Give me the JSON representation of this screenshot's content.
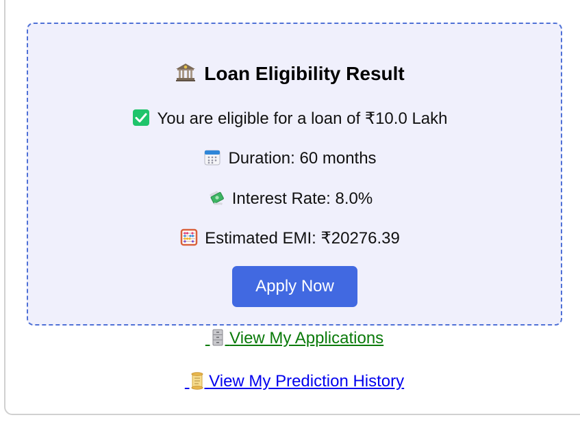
{
  "result": {
    "title": "Loan Eligibility Result",
    "eligible_text": "You are eligible for a loan of ₹10.0 Lakh",
    "duration_text": "Duration: 60 months",
    "interest_text": "Interest Rate: 8.0%",
    "emi_text": "Estimated EMI: ₹20276.39",
    "apply_button_label": "Apply Now",
    "icons": {
      "title": "bank-icon",
      "eligible": "check-mark-icon",
      "duration": "calendar-icon",
      "interest": "money-with-wings-icon",
      "emi": "abacus-icon"
    },
    "loan_amount_lakh": 10.0,
    "duration_months": 60,
    "interest_rate_percent": 8.0,
    "emi_amount": 20276.39
  },
  "links": {
    "applications_label": "View My Applications",
    "applications_icon": "filing-cabinet-icon",
    "history_label": "View My Prediction History",
    "history_icon": "scroll-icon"
  },
  "colors": {
    "accent": "#4169e1",
    "box_border": "#4e70d6",
    "box_background": "#f0f0fc",
    "applications_link": "#0a7a0a",
    "history_link": "#0000ee",
    "check_green": "#2ecc71"
  }
}
